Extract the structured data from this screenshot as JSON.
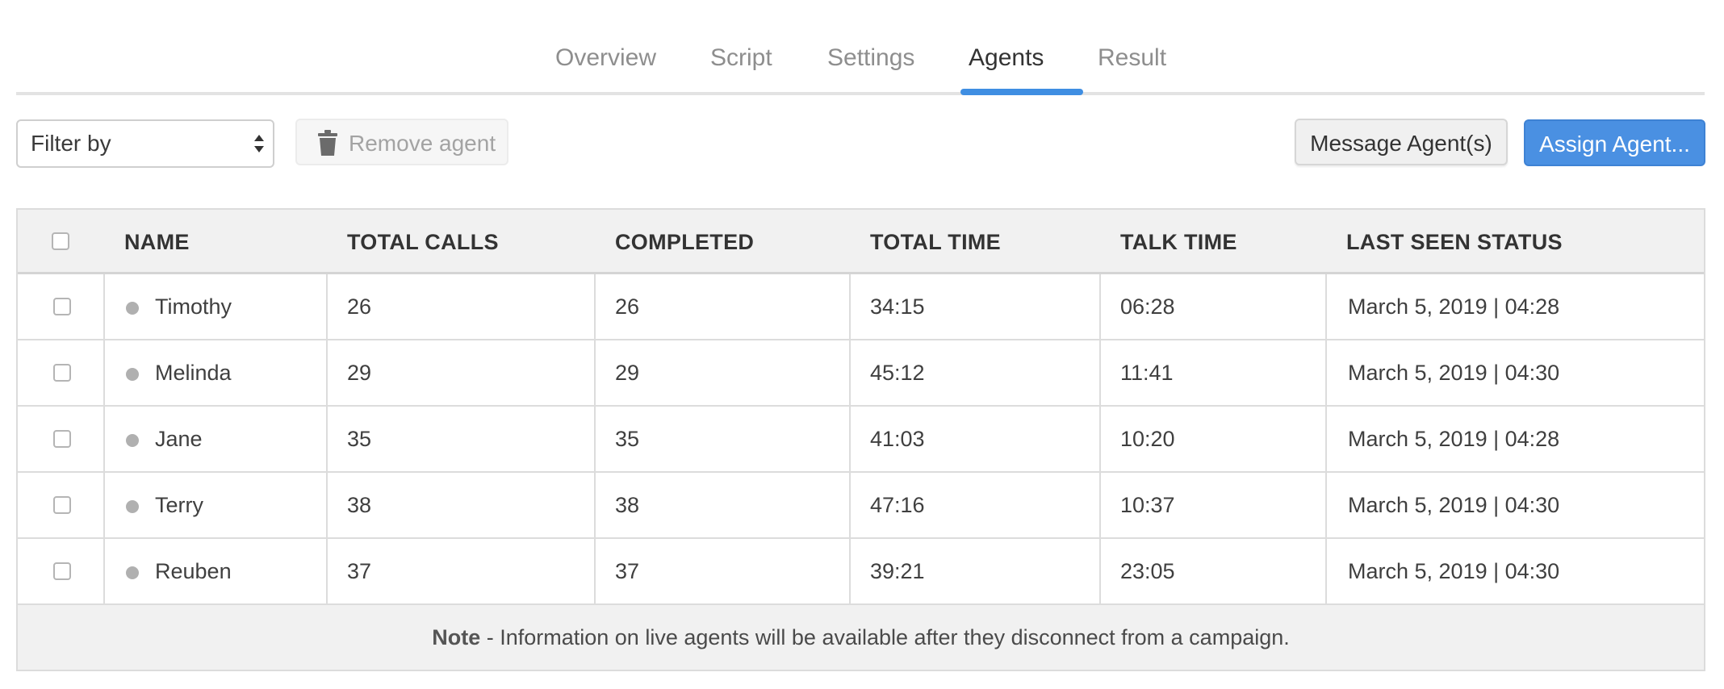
{
  "tabs": [
    {
      "label": "Overview"
    },
    {
      "label": "Script"
    },
    {
      "label": "Settings"
    },
    {
      "label": "Agents",
      "active": true
    },
    {
      "label": "Result"
    }
  ],
  "toolbar": {
    "filter_label": "Filter by",
    "remove_label": "Remove agent",
    "message_label": "Message Agent(s)",
    "assign_label": "Assign Agent..."
  },
  "table": {
    "headers": {
      "name": "NAME",
      "total_calls": "TOTAL CALLS",
      "completed": "COMPLETED",
      "total_time": "TOTAL TIME",
      "talk_time": "TALK TIME",
      "last_seen": "LAST SEEN STATUS"
    },
    "rows": [
      {
        "name": "Timothy",
        "total_calls": "26",
        "completed": "26",
        "total_time": "34:15",
        "talk_time": "06:28",
        "last_seen": "March 5, 2019 | 04:28"
      },
      {
        "name": "Melinda",
        "total_calls": "29",
        "completed": "29",
        "total_time": "45:12",
        "talk_time": "11:41",
        "last_seen": "March 5, 2019 | 04:30"
      },
      {
        "name": "Jane",
        "total_calls": "35",
        "completed": "35",
        "total_time": "41:03",
        "talk_time": "10:20",
        "last_seen": "March 5, 2019 | 04:28"
      },
      {
        "name": "Terry",
        "total_calls": "38",
        "completed": "38",
        "total_time": "47:16",
        "talk_time": "10:37",
        "last_seen": "March 5, 2019 | 04:30"
      },
      {
        "name": "Reuben",
        "total_calls": "37",
        "completed": "37",
        "total_time": "39:21",
        "talk_time": "23:05",
        "last_seen": "March 5, 2019 | 04:30"
      }
    ],
    "note_bold": "Note",
    "note_text": " - Information on live agents will be available after they disconnect from a campaign."
  },
  "colors": {
    "accent": "#4a90e2",
    "status_dot": "#b0b0b0"
  }
}
